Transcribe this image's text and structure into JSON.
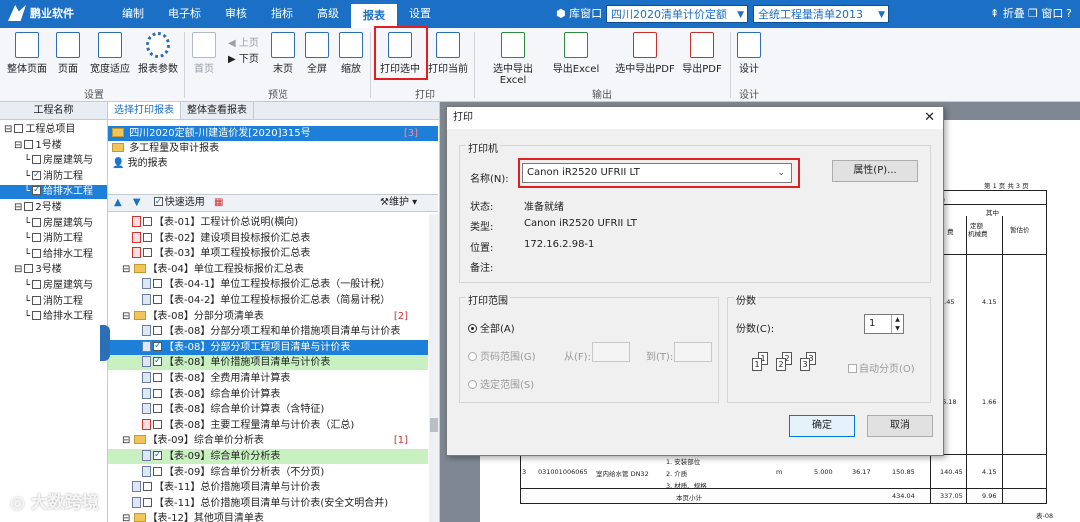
{
  "app": {
    "name": "鹏业软件"
  },
  "menu": [
    "编制",
    "电子标",
    "审核",
    "指标",
    "高级",
    "报表",
    "设置"
  ],
  "menu_active": "报表",
  "header": {
    "library_window": "库窗口",
    "quota_select": "四川2020清单计价定额",
    "bill_select": "全统工程量清单2013",
    "fold": "折叠",
    "window": "窗口",
    "help": "帮助"
  },
  "ribbon": {
    "buttons": {
      "whole_page": "整体页面",
      "page": "页面",
      "fit_width": "宽度适应",
      "report_params": "报表参数",
      "first_page": "首页",
      "prev_page": "上页",
      "next_page": "下页",
      "last_page": "末页",
      "fullscreen": "全屏",
      "zoom": "缩放",
      "print_selected": "打印选中",
      "print_current": "打印当前",
      "export_selected_excel": "选中导出Excel",
      "export_excel": "导出Excel",
      "export_selected_pdf": "选中导出PDF",
      "export_pdf": "导出PDF",
      "design": "设计"
    },
    "groups": {
      "settings": "设置",
      "preview": "预览",
      "print": "打印",
      "output": "输出",
      "design": "设计"
    }
  },
  "left_panel": {
    "header": "工程名称",
    "tree": [
      {
        "label": "工程总项目",
        "level": 0,
        "checked": false
      },
      {
        "label": "1号楼",
        "level": 1,
        "checked": false
      },
      {
        "label": "房屋建筑与",
        "level": 2,
        "checked": false
      },
      {
        "label": "消防工程",
        "level": 2,
        "checked": true
      },
      {
        "label": "给排水工程",
        "level": 2,
        "checked": true,
        "selected": true
      },
      {
        "label": "2号楼",
        "level": 1,
        "checked": false
      },
      {
        "label": "房屋建筑与",
        "level": 2,
        "checked": false
      },
      {
        "label": "消防工程",
        "level": 2,
        "checked": false
      },
      {
        "label": "给排水工程",
        "level": 2,
        "checked": false
      },
      {
        "label": "3号楼",
        "level": 1,
        "checked": false
      },
      {
        "label": "房屋建筑与",
        "level": 2,
        "checked": false
      },
      {
        "label": "消防工程",
        "level": 2,
        "checked": false
      },
      {
        "label": "给排水工程",
        "level": 2,
        "checked": false
      }
    ]
  },
  "middle_panel": {
    "tabs": [
      "选择打印报表",
      "整体查看报表"
    ],
    "top_items": [
      {
        "label": "四川2020定额-川建造价发[2020]315号",
        "count": "[3]",
        "style": "blue"
      },
      {
        "label": "多工程量及审计报表",
        "style": "normal"
      },
      {
        "label": "我的报表",
        "style": "normal"
      }
    ],
    "quick_select": "快速选用",
    "maintain": "维护",
    "reports": [
      {
        "label": "【表-01】工程计价总说明(横向)",
        "indent": 2,
        "type": "doc-red",
        "checked": false
      },
      {
        "label": "【表-02】建设项目投标报价汇总表",
        "indent": 2,
        "type": "doc-red",
        "checked": false
      },
      {
        "label": "【表-03】单项工程投标报价汇总表",
        "indent": 2,
        "type": "doc-red",
        "checked": false
      },
      {
        "label": "【表-04】单位工程投标报价汇总表",
        "indent": 1,
        "type": "folder",
        "checked": false
      },
      {
        "label": "【表-04-1】单位工程投标报价汇总表（一般计税）",
        "indent": 3,
        "type": "doc",
        "checked": false
      },
      {
        "label": "【表-04-2】单位工程投标报价汇总表（简易计税）",
        "indent": 3,
        "type": "doc",
        "checked": false
      },
      {
        "label": "【表-08】分部分项清单表",
        "indent": 1,
        "type": "folder",
        "count": "[2]"
      },
      {
        "label": "【表-08】分部分项工程和单价措施项目清单与计价表",
        "indent": 3,
        "type": "doc",
        "checked": false
      },
      {
        "label": "【表-08】分部分项工程项目清单与计价表",
        "indent": 3,
        "type": "doc",
        "checked": true,
        "style": "blue"
      },
      {
        "label": "【表-08】单价措施项目清单与计价表",
        "indent": 3,
        "type": "doc",
        "checked": true,
        "style": "green"
      },
      {
        "label": "【表-08】全费用清单计算表",
        "indent": 3,
        "type": "doc",
        "checked": false
      },
      {
        "label": "【表-08】综合单价计算表",
        "indent": 3,
        "type": "doc",
        "checked": false
      },
      {
        "label": "【表-08】综合单价计算表（含特征)",
        "indent": 3,
        "type": "doc",
        "checked": false
      },
      {
        "label": "【表-08】主要工程量清单与计价表（汇总)",
        "indent": 3,
        "type": "doc-red",
        "checked": false
      },
      {
        "label": "【表-09】综合单价分析表",
        "indent": 1,
        "type": "folder",
        "count": "[1]"
      },
      {
        "label": "【表-09】综合单价分析表",
        "indent": 3,
        "type": "doc",
        "checked": true,
        "style": "green"
      },
      {
        "label": "【表-09】综合单价分析表（不分页)",
        "indent": 3,
        "type": "doc",
        "checked": false
      },
      {
        "label": "【表-11】总价措施项目清单与计价表",
        "indent": 2,
        "type": "doc",
        "checked": false
      },
      {
        "label": "【表-11】总价措施项目清单与计价表(安全文明合并)",
        "indent": 2,
        "type": "doc",
        "checked": false
      },
      {
        "label": "【表-12】其他项目清单表",
        "indent": 1,
        "type": "folder"
      }
    ]
  },
  "preview": {
    "page_info": "第 1 页 共 3 页",
    "suffix": "元)",
    "col_among": "其中",
    "col_quota": "定额",
    "col_machine": "机械费",
    "col_estimate": "暂估价",
    "col_fee": "费",
    "values_row1": [
      "0.45",
      "4.15"
    ],
    "values_row2": [
      "6.18",
      "1.66"
    ],
    "row": [
      "3",
      "031001006065",
      "室内给水管 DN32",
      "1. 安装部位",
      "2. 介质",
      "3. 材质、规格",
      "m",
      "5.000",
      "36.17",
      "150.85",
      "140.45",
      "4.15"
    ],
    "subtotal_label": "本页小计",
    "subtotal": [
      "434.04",
      "337.05",
      "9.96"
    ],
    "footer": "表-08"
  },
  "dialog": {
    "title": "打印",
    "printer_group": "打印机",
    "name_label": "名称(N):",
    "printer_name": "Canon iR2520 UFRII LT",
    "properties": "属性(P)...",
    "status_label": "状态:",
    "status_value": "准备就绪",
    "type_label": "类型:",
    "type_value": "Canon iR2520 UFRII LT",
    "location_label": "位置:",
    "location_value": "172.16.2.98-1",
    "comment_label": "备注:",
    "range_group": "打印范围",
    "range_all": "全部(A)",
    "range_pages": "页码范围(G)",
    "from_label": "从(F):",
    "to_label": "到(T):",
    "range_selection": "选定范围(S)",
    "copies_group": "份数",
    "copies_label": "份数(C):",
    "copies_value": "1",
    "collate": "自动分页(O)",
    "ok": "确定",
    "cancel": "取消"
  },
  "watermark": "大数跨境"
}
